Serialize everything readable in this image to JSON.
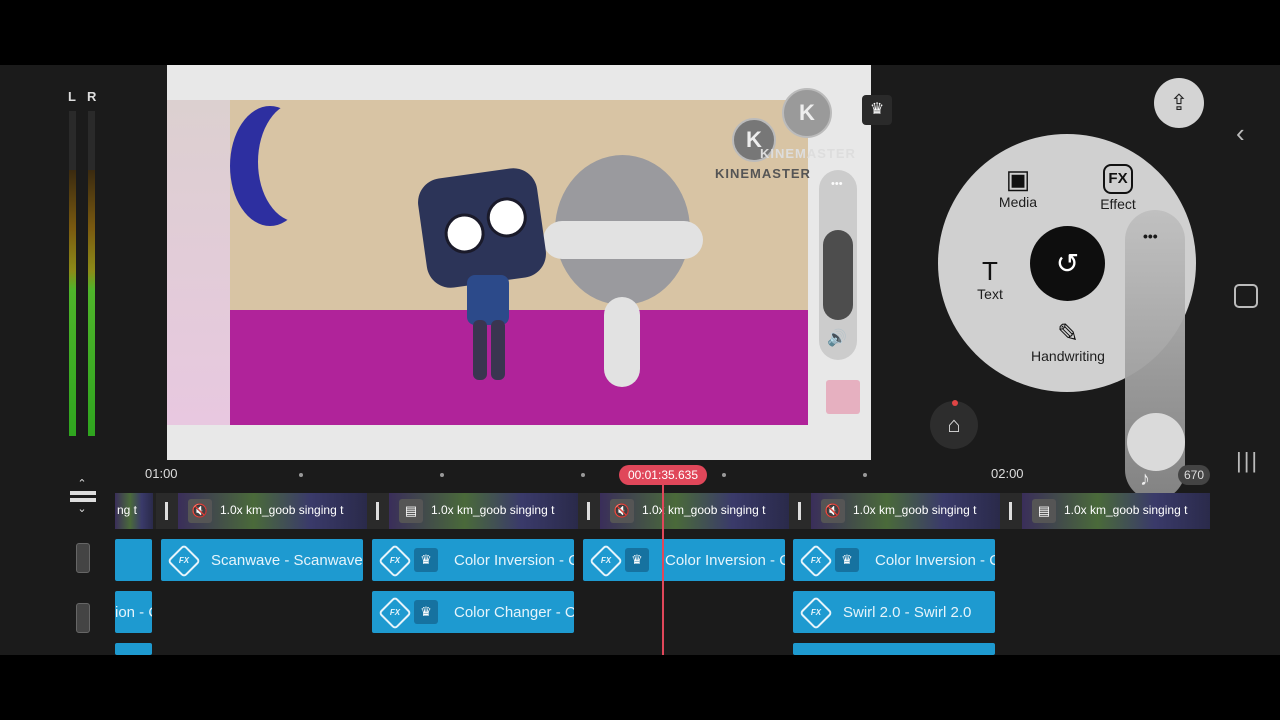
{
  "meters": {
    "left_label": "L",
    "right_label": "R",
    "left_level": 0.82,
    "right_level": 0.82
  },
  "preview": {
    "watermark_text": "KINEMASTER",
    "watermark_letter": "K",
    "overlay_watermark_text": "KINEMASTER"
  },
  "toolbar": {
    "share_icon": "share-lock-icon",
    "store_icon": "store-icon"
  },
  "wheel": {
    "media_label": "Media",
    "effect_label": "Effect",
    "effect_glyph": "FX",
    "text_label": "Text",
    "text_glyph": "T",
    "handwriting_label": "Handwriting",
    "center_icon": "undo-circle-icon",
    "more_glyph": "•••"
  },
  "timeline": {
    "ruler_start": "01:00",
    "ruler_end": "02:00",
    "playhead_time": "00:01:35.635",
    "end_time_fragment": "670",
    "video_clips": [
      {
        "label": "ng t",
        "icon": ""
      },
      {
        "label": "1.0x km_goob singing t",
        "icon": "muted"
      },
      {
        "label": "1.0x km_goob singing t",
        "icon": "film"
      },
      {
        "label": "1.0x km_goob singing t",
        "icon": "muted"
      },
      {
        "label": "1.0x km_goob singing t",
        "icon": "muted"
      },
      {
        "label": "1.0x km_goob singing t",
        "icon": "film"
      }
    ],
    "fx_row1": [
      {
        "label": "",
        "crown": false
      },
      {
        "label": "Scanwave - Scanwave",
        "crown": false
      },
      {
        "label": "Color Inversion - C",
        "crown": true
      },
      {
        "label": "Color Inversion - C",
        "crown": true
      },
      {
        "label": "Color Inversion - C",
        "crown": true
      }
    ],
    "fx_row2": [
      {
        "label": "ion - C",
        "crown": false
      },
      {
        "label": "Color Changer - C",
        "crown": true
      },
      {
        "label": "Swirl 2.0 - Swirl 2.0",
        "crown": false
      }
    ]
  },
  "system_nav": {
    "back": "‹",
    "recent": "|||"
  }
}
